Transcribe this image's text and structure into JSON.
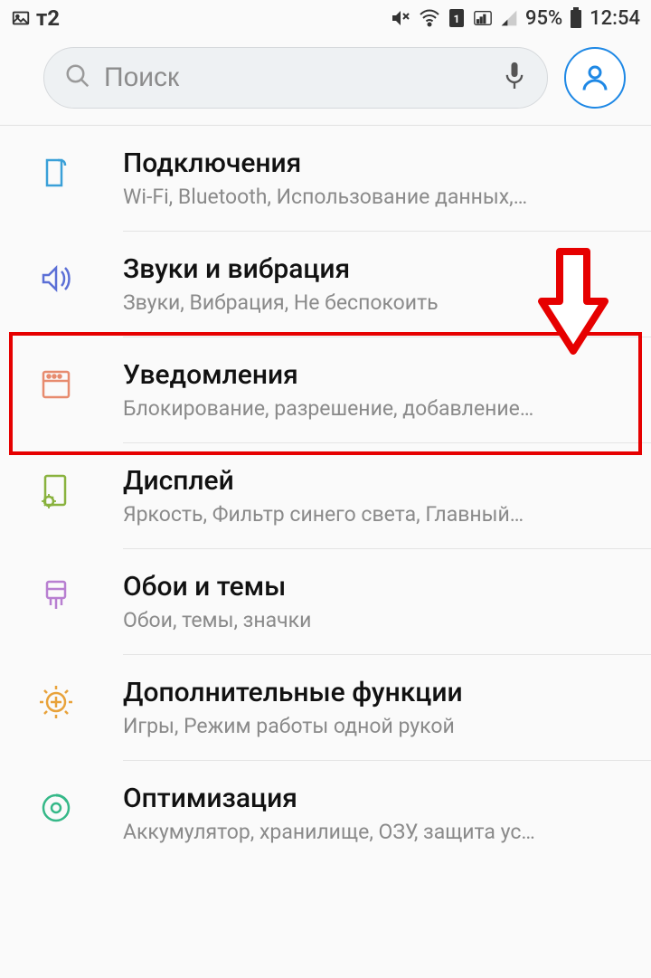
{
  "statusbar": {
    "carrier": "т2",
    "battery_pct": "95%",
    "time": "12:54"
  },
  "search": {
    "placeholder": "Поиск"
  },
  "items": [
    {
      "title": "Подключения",
      "subtitle": "Wi-Fi, Bluetooth, Использование данных,…"
    },
    {
      "title": "Звуки и вибрация",
      "subtitle": "Звуки, Вибрация, Не беспокоить"
    },
    {
      "title": "Уведомления",
      "subtitle": "Блокирование, разрешение, добавление…"
    },
    {
      "title": "Дисплей",
      "subtitle": "Яркость, Фильтр синего света, Главный…"
    },
    {
      "title": "Обои и темы",
      "subtitle": "Обои, темы, значки"
    },
    {
      "title": "Дополнительные функции",
      "subtitle": "Игры, Режим работы одной рукой"
    },
    {
      "title": "Оптимизация",
      "subtitle": "Аккумулятор, хранилище, ОЗУ, защита ус…"
    }
  ],
  "annotation": {
    "highlighted_index": 2
  }
}
